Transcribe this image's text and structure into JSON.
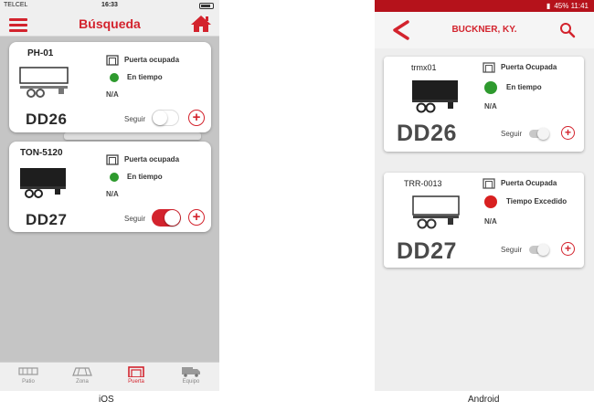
{
  "colors": {
    "accent": "#d3232d",
    "green": "#2e9a2e",
    "red": "#d82020"
  },
  "ios": {
    "status": {
      "carrier": "TELCEL",
      "time": "16:33"
    },
    "nav": {
      "title": "Búsqueda",
      "menu_icon": "hamburger-icon",
      "home_icon": "home-icon"
    },
    "cards": [
      {
        "code": "PH-01",
        "dock": "DD26",
        "door_status": "Puerta ocupada",
        "time_status": "En tiempo",
        "na": "N/A",
        "follow_label": "Seguir",
        "follow_on": false
      },
      {
        "code": "TON-5120",
        "dock": "DD27",
        "door_status": "Puerta ocupada",
        "time_status": "En tiempo",
        "na": "N/A",
        "follow_label": "Seguir",
        "follow_on": true
      }
    ],
    "tabs": [
      {
        "label": "Patio",
        "active": false
      },
      {
        "label": "Zona",
        "active": false
      },
      {
        "label": "Puerta",
        "active": true
      },
      {
        "label": "Equipo",
        "active": false
      }
    ],
    "caption": "iOS"
  },
  "android": {
    "status": {
      "text": "45%",
      "time": "11:41"
    },
    "bar": {
      "title": "BUCKNER, KY.",
      "back_icon": "back-arrow-icon",
      "search_icon": "search-icon"
    },
    "cards": [
      {
        "code": "trmx01",
        "dock": "DD26",
        "door_status": "Puerta Ocupada",
        "time_status": "En tiempo",
        "time_color": "green",
        "na": "N/A",
        "follow_label": "Seguir"
      },
      {
        "code": "TRR-0013",
        "dock": "DD27",
        "door_status": "Puerta Ocupada",
        "time_status": "Tiempo Excedido",
        "time_color": "red",
        "na": "N/A",
        "follow_label": "Seguir"
      }
    ],
    "caption": "Android"
  }
}
